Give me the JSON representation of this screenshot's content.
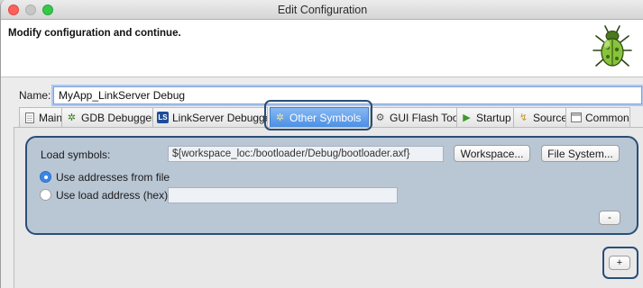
{
  "window": {
    "title": "Edit Configuration",
    "header_message": "Modify configuration and continue."
  },
  "name_field": {
    "label": "Name:",
    "value": "MyApp_LinkServer Debug"
  },
  "tabs": [
    {
      "label": "Main",
      "icon": "document-icon"
    },
    {
      "label": "GDB Debugger",
      "icon": "bug-gear-icon"
    },
    {
      "label": "LinkServer Debugger",
      "icon": "ls-icon"
    },
    {
      "label": "Other Symbols",
      "icon": "gear-icon",
      "active": true
    },
    {
      "label": "GUI Flash Tool",
      "icon": "flash-icon"
    },
    {
      "label": "Startup",
      "icon": "play-icon"
    },
    {
      "label": "Source",
      "icon": "source-icon"
    },
    {
      "label": "Common",
      "icon": "common-icon"
    }
  ],
  "symbols": {
    "load_label": "Load symbols:",
    "path_value": "${workspace_loc:/bootloader/Debug/bootloader.axf}",
    "workspace_button": "Workspace...",
    "filesystem_button": "File System...",
    "radio_file_label": "Use addresses from file",
    "radio_file_checked": true,
    "radio_load_label": "Use load address (hex):",
    "radio_load_checked": false,
    "load_address_value": "",
    "remove_button": "-",
    "add_button": "+"
  },
  "colors": {
    "panel_bg": "#b9c6d4",
    "highlight_border": "#2a4e76",
    "active_tab": "#4c90e6",
    "radio_checked": "#3b86e8"
  }
}
